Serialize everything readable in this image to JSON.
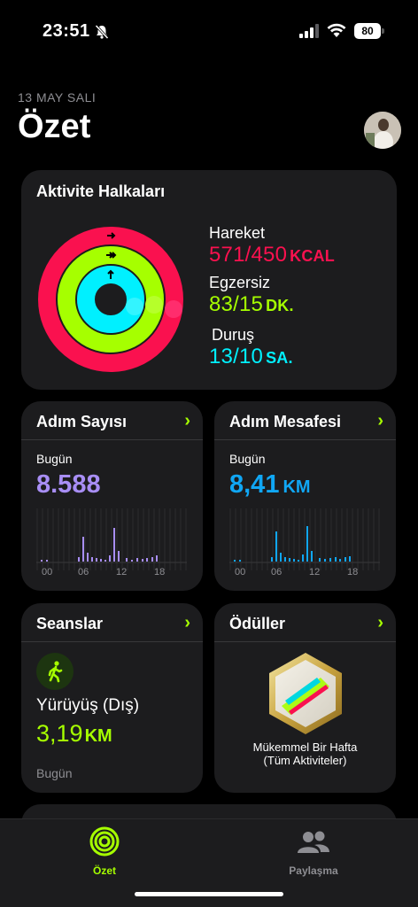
{
  "status_bar": {
    "time": "23:51",
    "battery": "80",
    "icons": [
      "bell-slash-icon",
      "cellular-signal-icon",
      "wifi-icon",
      "battery-icon"
    ]
  },
  "header": {
    "date": "13 MAY SALI",
    "title": "Özet"
  },
  "activity_rings": {
    "title": "Aktivite Halkaları",
    "move": {
      "label": "Hareket",
      "value": "571/450",
      "unit": "KCAL",
      "progress": 1.27
    },
    "exercise": {
      "label": "Egzersiz",
      "value": "83/15",
      "unit": "DK.",
      "progress": 5.53
    },
    "stand": {
      "label": "Duruş",
      "value": "13/10",
      "unit": "SA.",
      "progress": 1.3
    },
    "colors": {
      "move": "#fa114f",
      "exercise": "#a6ff00",
      "stand": "#00f0ff"
    }
  },
  "step_count": {
    "title": "Adım Sayısı",
    "today_label": "Bugün",
    "value": "8.588",
    "hour_ticks": [
      "00",
      "06",
      "12",
      "18"
    ],
    "color": "#a88ef5"
  },
  "step_distance": {
    "title": "Adım Mesafesi",
    "today_label": "Bugün",
    "value": "8,41",
    "unit": "KM",
    "hour_ticks": [
      "00",
      "06",
      "12",
      "18"
    ],
    "color": "#10a7f5"
  },
  "sessions": {
    "title": "Seanslar",
    "workout_name": "Yürüyüş (Dış)",
    "value": "3,19",
    "unit": "KM",
    "date": "Bugün"
  },
  "awards": {
    "title": "Ödüller",
    "award_name": "Mükemmel Bir Hafta",
    "award_subtitle": "(Tüm Aktiviteler)"
  },
  "tab_bar": {
    "tabs": [
      {
        "label": "Özet",
        "icon": "activity-rings-icon",
        "active": true
      },
      {
        "label": "Paylaşma",
        "icon": "people-icon",
        "active": false
      }
    ]
  }
}
